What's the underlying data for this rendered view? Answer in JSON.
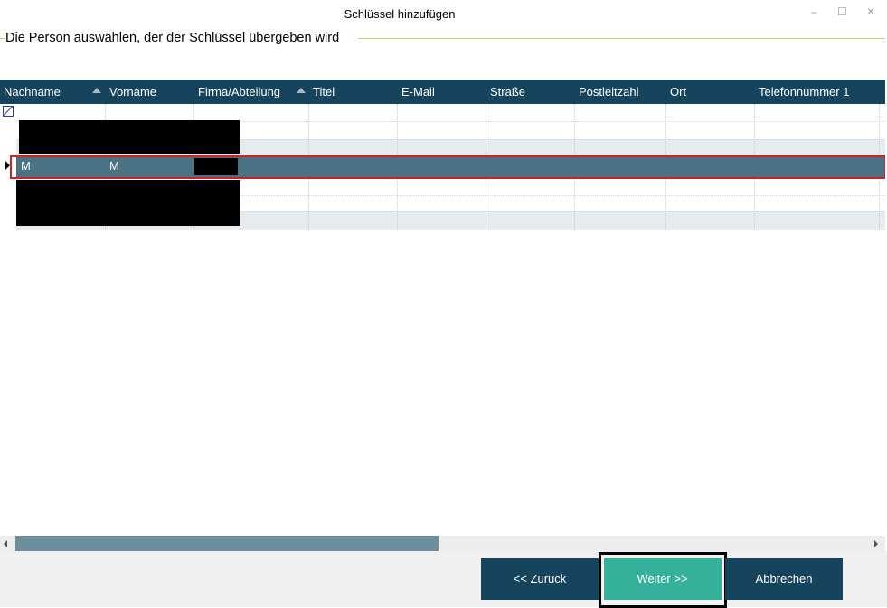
{
  "window": {
    "title": "Schlüssel hinzufügen",
    "minimize_glyph": "–",
    "maximize_glyph": "☐",
    "close_glyph": "×"
  },
  "section": {
    "header": "Die Person auswählen, der der Schlüssel übergeben wird"
  },
  "grid": {
    "columns": [
      "Nachname",
      "Vorname",
      "Firma/Abteilung",
      "Titel",
      "E-Mail",
      "Straße",
      "Postleitzahl",
      "Ort",
      "Telefonnummer 1"
    ],
    "selected_row": {
      "nachname": "M",
      "vorname": "M"
    }
  },
  "footer": {
    "back_label": "<< Zurück",
    "next_label": "Weiter >>",
    "cancel_label": "Abbrechen"
  },
  "colors": {
    "header_bg": "#17445d",
    "selected_bg": "#4a7285",
    "primary_button": "#35b09a",
    "accent_line": "#c5d36a",
    "highlight_frame": "#d32020"
  }
}
